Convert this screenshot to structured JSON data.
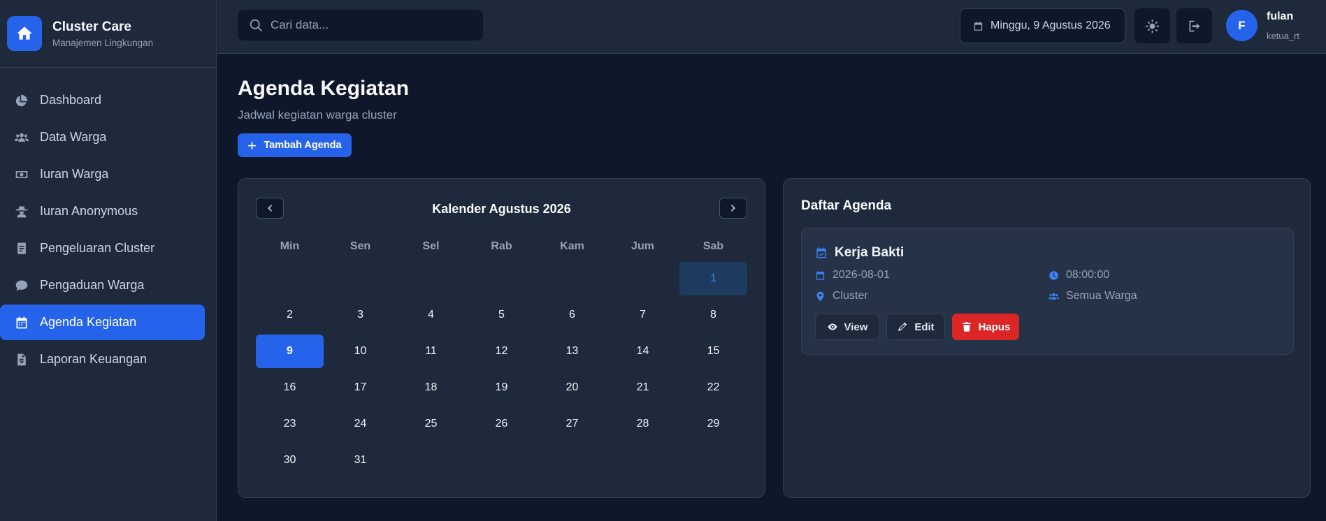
{
  "brand": {
    "title": "Cluster Care",
    "subtitle": "Manajemen Lingkungan"
  },
  "sidebar": {
    "items": [
      {
        "label": "Dashboard",
        "icon": "chart-pie-icon"
      },
      {
        "label": "Data Warga",
        "icon": "users-icon"
      },
      {
        "label": "Iuran Warga",
        "icon": "money-bill-icon"
      },
      {
        "label": "Iuran Anonymous",
        "icon": "user-secret-icon"
      },
      {
        "label": "Pengeluaran Cluster",
        "icon": "receipt-icon"
      },
      {
        "label": "Pengaduan Warga",
        "icon": "comment-icon"
      },
      {
        "label": "Agenda Kegiatan",
        "icon": "calendar-icon",
        "active": true
      },
      {
        "label": "Laporan Keuangan",
        "icon": "file-invoice-icon"
      }
    ]
  },
  "topbar": {
    "search_placeholder": "Cari data...",
    "date": "Minggu, 9 Agustus 2026",
    "user_initial": "F",
    "user_name": "fulan",
    "user_role": "ketua_rt"
  },
  "page": {
    "title": "Agenda Kegiatan",
    "subtitle": "Jadwal kegiatan warga cluster",
    "add_button": "Tambah Agenda"
  },
  "calendar": {
    "title": "Kalender Agustus 2026",
    "weekdays": [
      "Min",
      "Sen",
      "Sel",
      "Rab",
      "Kam",
      "Jum",
      "Sab"
    ],
    "weeks": [
      [
        "",
        "",
        "",
        "",
        "",
        "",
        "1"
      ],
      [
        "2",
        "3",
        "4",
        "5",
        "6",
        "7",
        "8"
      ],
      [
        "9",
        "10",
        "11",
        "12",
        "13",
        "14",
        "15"
      ],
      [
        "16",
        "17",
        "18",
        "19",
        "20",
        "21",
        "22"
      ],
      [
        "23",
        "24",
        "25",
        "26",
        "27",
        "28",
        "29"
      ],
      [
        "30",
        "31",
        "",
        "",
        "",
        "",
        ""
      ]
    ],
    "event_day": "1",
    "today": "9"
  },
  "agenda": {
    "title": "Daftar Agenda",
    "items": [
      {
        "name": "Kerja Bakti",
        "date": "2026-08-01",
        "time": "08:00:00",
        "location": "Cluster",
        "participants": "Semua Warga",
        "view_label": "View",
        "edit_label": "Edit",
        "delete_label": "Hapus"
      }
    ]
  },
  "colors": {
    "accent": "#2563eb",
    "danger": "#dc2626",
    "background": "#0f172a",
    "panel": "#1e293b"
  }
}
